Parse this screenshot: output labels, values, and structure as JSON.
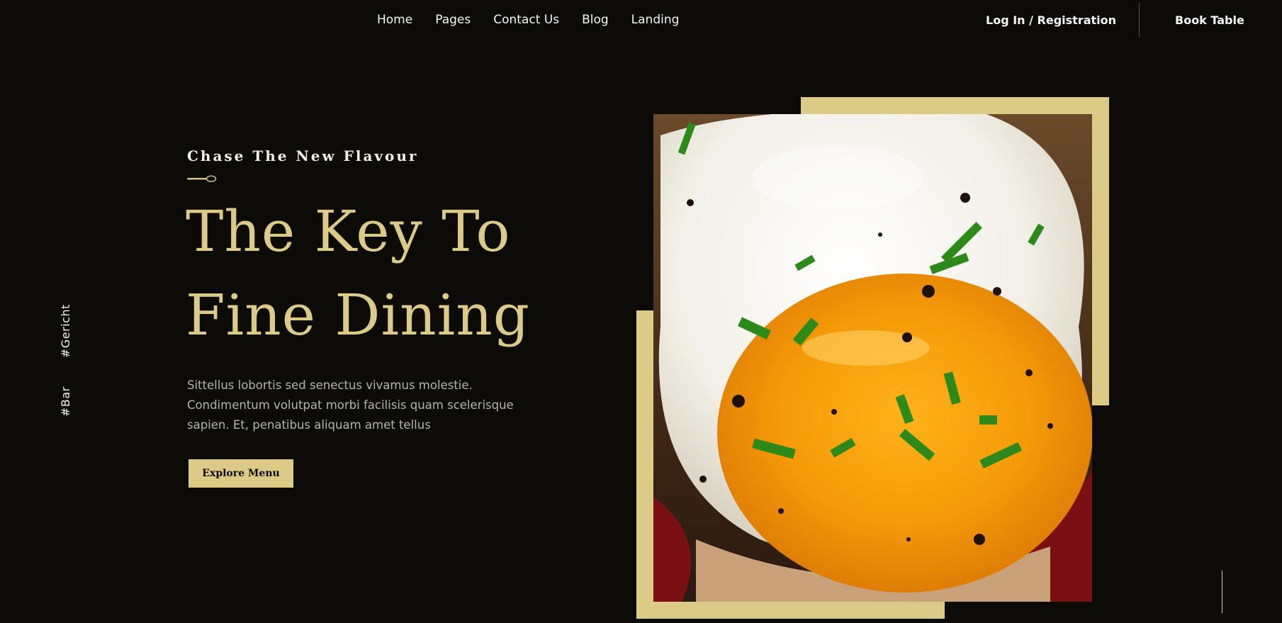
{
  "nav": {
    "links": [
      "Home",
      "Pages",
      "Contact Us",
      "Blog",
      "Landing"
    ],
    "login_label": "Log In / Registration",
    "book_label": "Book Table"
  },
  "side_tags": [
    "#Gericht",
    "#Bar"
  ],
  "hero": {
    "subtitle": "Chase The New Flavour",
    "headline_line1": "The Key To",
    "headline_line2": "Fine Dining",
    "description": "Sittellus lobortis sed senectus vivamus molestie. Condimentum volutpat morbi facilisis quam scelerisque sapien. Et, penatibus aliquam amet tellus",
    "cta_label": "Explore Menu"
  },
  "colors": {
    "background": "#0c0b08",
    "accent_gold": "#dcca87",
    "text_light": "#f5f5f5",
    "text_muted": "#b7b3aa"
  },
  "icons": {
    "divider": "spoon-icon"
  }
}
